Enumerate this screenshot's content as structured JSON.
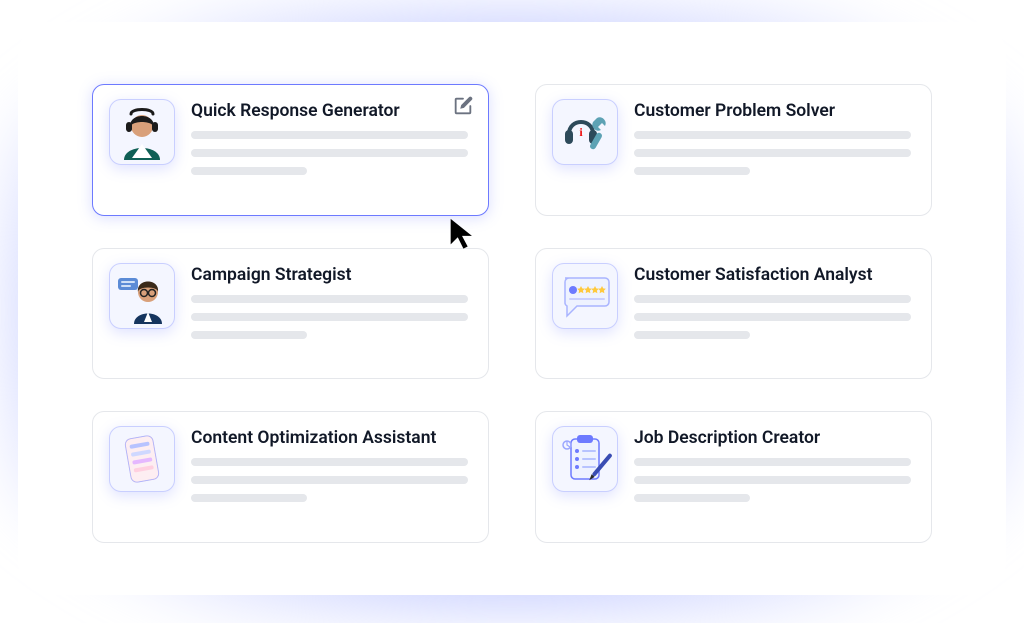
{
  "cards": [
    {
      "title": "Quick Response Generator",
      "icon": "agent-avatar",
      "selected": true,
      "editable": true
    },
    {
      "title": "Customer Problem Solver",
      "icon": "headset-wrench",
      "selected": false,
      "editable": false
    },
    {
      "title": "Campaign Strategist",
      "icon": "analyst-avatar",
      "selected": false,
      "editable": false
    },
    {
      "title": "Customer Satisfaction Analyst",
      "icon": "review-bubble",
      "selected": false,
      "editable": false
    },
    {
      "title": "Content Optimization Assistant",
      "icon": "checklist-sheet",
      "selected": false,
      "editable": false
    },
    {
      "title": "Job Description Creator",
      "icon": "clipboard-pen",
      "selected": false,
      "editable": false
    }
  ]
}
